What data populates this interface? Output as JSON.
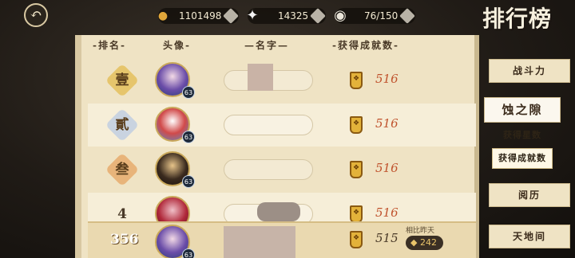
{
  "page": {
    "title": "排行榜"
  },
  "resources": {
    "coins": "1101498",
    "gems": "14325",
    "stamina": "76/150"
  },
  "columns": [
    "排名",
    "头像",
    "名字",
    "获得成就数"
  ],
  "rows": [
    {
      "rank": "壹",
      "level": "63",
      "count": "516"
    },
    {
      "rank": "貳",
      "level": "63",
      "count": "516"
    },
    {
      "rank": "叁",
      "level": "63",
      "count": "516"
    },
    {
      "rank": "4",
      "level": "",
      "count": "516"
    }
  ],
  "my_row": {
    "rank": "356",
    "level": "63",
    "count": "515",
    "compare_label": "相比昨天",
    "compare_value": "242"
  },
  "tabs": {
    "tab1": "战斗力",
    "tab2": "蚀之隙",
    "sub1": "获得星数",
    "sub2": "获得成就数",
    "tab3": "阅历",
    "tab4": "天地间"
  },
  "colors": {
    "accent": "#c0532e",
    "gold": "#e3b23a",
    "paper": "#efe3c4"
  }
}
